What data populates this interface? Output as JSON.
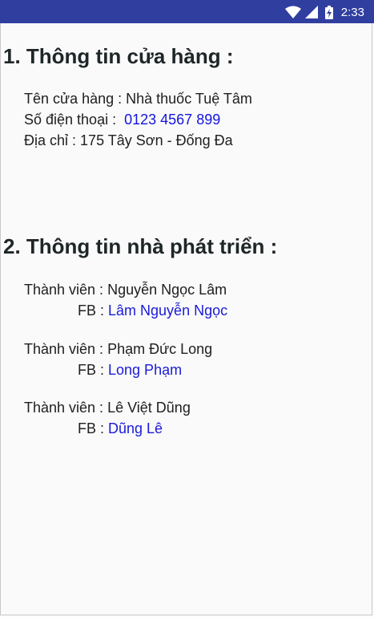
{
  "status_bar": {
    "time": "2:33",
    "background": "#303f9f"
  },
  "store": {
    "heading": "1. Thông tin cửa hàng :",
    "name_label": "Tên cửa hàng :",
    "name_value": "Nhà thuốc Tuệ Tâm",
    "phone_label": "Số điện thoại :",
    "phone_value": "0123 4567 899",
    "address_label": "Địa chỉ :",
    "address_value": "175 Tây Sơn - Đống Đa"
  },
  "developers": {
    "heading": "2. Thông tin nhà phát triển :",
    "member_label": "Thành viên :",
    "fb_label": "FB :",
    "members": [
      {
        "name": "Nguyễn Ngọc Lâm",
        "fb": "Lâm Nguyễn Ngọc"
      },
      {
        "name": "Phạm Đức Long",
        "fb": "Long Phạm"
      },
      {
        "name": "Lê Việt Dũng",
        "fb": "Dũng Lê"
      }
    ]
  },
  "colors": {
    "link": "#1a1ad8",
    "heading": "#1f2628",
    "background": "#fafafa"
  }
}
